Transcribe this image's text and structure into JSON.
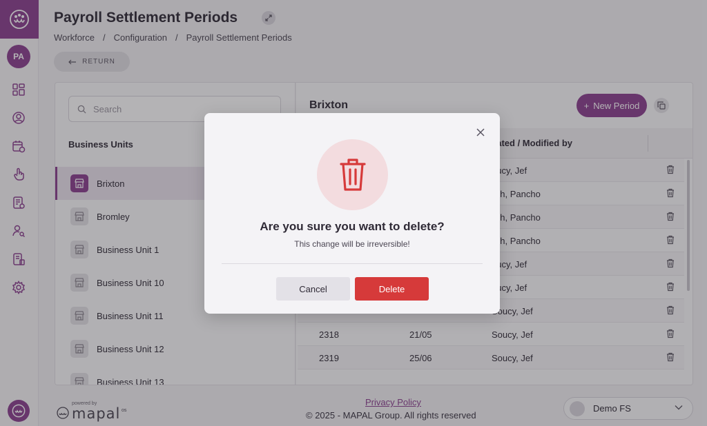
{
  "header": {
    "title": "Payroll Settlement Periods",
    "breadcrumb": [
      "Workforce",
      "Configuration",
      "Payroll Settlement Periods"
    ],
    "return_label": "RETURN"
  },
  "sidebar": {
    "avatar_initials": "PA",
    "icons": [
      "dashboard-icon",
      "user-circle-icon",
      "calendar-clock-icon",
      "hand-pointer-icon",
      "document-icon",
      "user-search-icon",
      "report-icon",
      "gear-icon"
    ]
  },
  "left_panel": {
    "search_placeholder": "Search",
    "section_title": "Business Units",
    "items": [
      {
        "label": "Brixton",
        "selected": true
      },
      {
        "label": "Bromley",
        "selected": false
      },
      {
        "label": "Business Unit 1",
        "selected": false
      },
      {
        "label": "Business Unit 10",
        "selected": false
      },
      {
        "label": "Business Unit 11",
        "selected": false
      },
      {
        "label": "Business Unit 12",
        "selected": false
      },
      {
        "label": "Business Unit 13",
        "selected": false
      }
    ]
  },
  "right_panel": {
    "title": "Brixton",
    "new_period_label": "New Period",
    "column_created": "eated / Modified by",
    "rows": [
      {
        "c1": "",
        "c2": "",
        "c3": "oucy, Jef"
      },
      {
        "c1": "",
        "c2": "",
        "c3": "lich, Pancho"
      },
      {
        "c1": "",
        "c2": "",
        "c3": "lich, Pancho"
      },
      {
        "c1": "",
        "c2": "",
        "c3": "lich, Pancho"
      },
      {
        "c1": "",
        "c2": "",
        "c3": "oucy, Jef"
      },
      {
        "c1": "",
        "c2": "",
        "c3": "oucy, Jef"
      },
      {
        "c1": "",
        "c2": "",
        "c3": "Soucy, Jef"
      },
      {
        "c1": "2318",
        "c2": "21/05",
        "c3": "Soucy, Jef"
      },
      {
        "c1": "2319",
        "c2": "25/06",
        "c3": "Soucy, Jef"
      }
    ]
  },
  "footer": {
    "powered_by": "powered by",
    "brand": "mapal",
    "brand_suffix": "os",
    "privacy": "Privacy Policy",
    "copyright": "© 2025 - MAPAL Group. All rights reserved",
    "org_name": "Demo FS"
  },
  "modal": {
    "title": "Are you sure you want to delete?",
    "subtitle": "This change will be irreversible!",
    "cancel_label": "Cancel",
    "delete_label": "Delete"
  },
  "colors": {
    "brand": "#8a3f8f",
    "danger": "#d63a3a",
    "danger_soft": "#f3dcdf"
  }
}
